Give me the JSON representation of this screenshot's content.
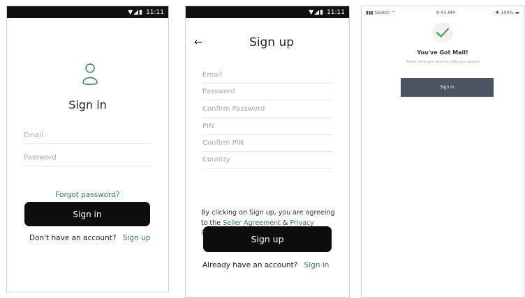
{
  "status_time": "11:11",
  "screen1": {
    "title": "Sign in",
    "email_placeholder": "Email",
    "password_placeholder": "Password",
    "forgot_label": "Forgot password?",
    "signin_button": "Sign in",
    "no_account_text": "Don't have an account?",
    "signup_link": "Sign up"
  },
  "screen2": {
    "title": "Sign up",
    "fields": [
      "Email",
      "Password",
      "Confirm Password",
      "PIN",
      "Confirm PIN",
      "Country"
    ],
    "agree_prefix": "By clicking on Sign up, you are agreeing to the",
    "seller_agreement": "Seller Agreement",
    "ampersand": "&",
    "privacy_policy": "Privacy Policy",
    "signup_button": "Sign up",
    "have_account_text": "Already have an account?",
    "signin_link": "Sign in"
  },
  "screen3": {
    "carrier": "Sketch",
    "time": "9:41 AM",
    "battery": "100%",
    "title": "You've Got Mail!",
    "subtitle": "Please check your email to verify your account",
    "button": "Sign in"
  },
  "colors": {
    "accent_green": "#2e7d5b",
    "button_dark": "#0d0d0d",
    "button_slate": "#4a5463",
    "check_green": "#3aa655"
  }
}
